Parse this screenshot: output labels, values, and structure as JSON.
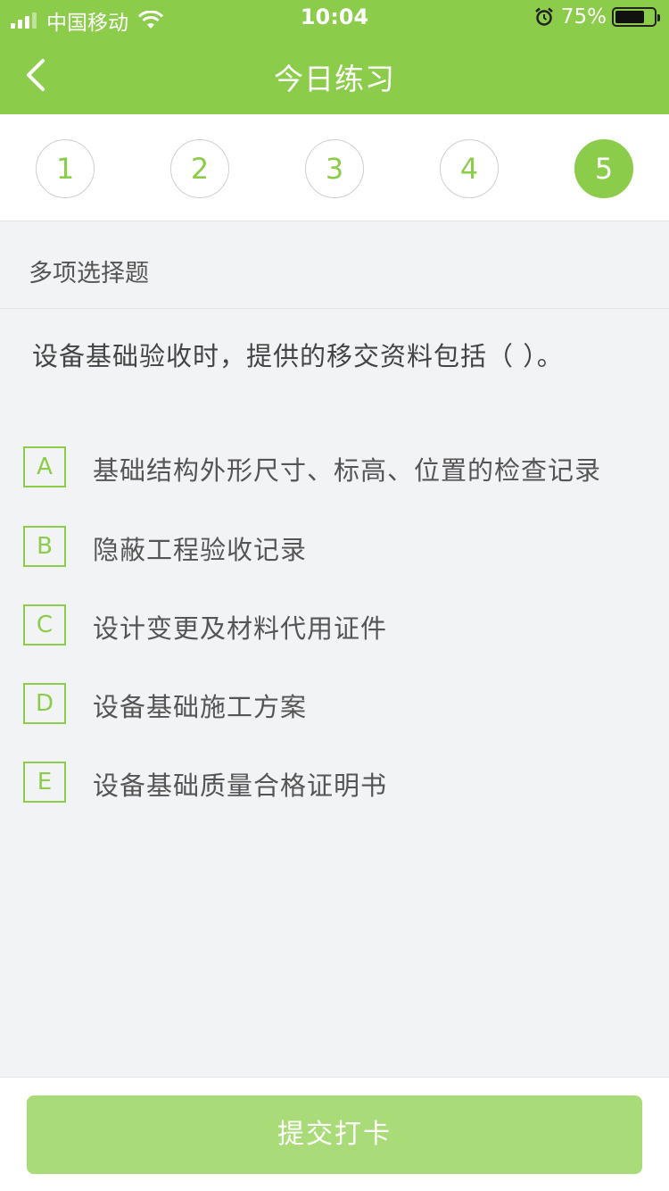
{
  "status_bar": {
    "carrier": "中国移动",
    "time": "10:04",
    "battery": "75%",
    "battery_level": 0.75
  },
  "nav": {
    "title": "今日练习",
    "back_icon": "chevron-left-icon"
  },
  "steps": [
    {
      "label": "1",
      "active": false
    },
    {
      "label": "2",
      "active": false
    },
    {
      "label": "3",
      "active": false
    },
    {
      "label": "4",
      "active": false
    },
    {
      "label": "5",
      "active": true
    }
  ],
  "question": {
    "type": "多项选择题",
    "text": "设备基础验收时，提供的移交资料包括（    ）。",
    "options": [
      {
        "letter": "A",
        "text": "基础结构外形尺寸、标高、位置的检查记录"
      },
      {
        "letter": "B",
        "text": "隐蔽工程验收记录"
      },
      {
        "letter": "C",
        "text": "设计变更及材料代用证件"
      },
      {
        "letter": "D",
        "text": "设备基础施工方案"
      },
      {
        "letter": "E",
        "text": "设备基础质量合格证明书"
      }
    ]
  },
  "footer": {
    "submit_label": "提交打卡"
  },
  "colors": {
    "accent": "#8ccc4b",
    "button_disabled": "#a9dc79",
    "background": "#f2f3f5"
  }
}
